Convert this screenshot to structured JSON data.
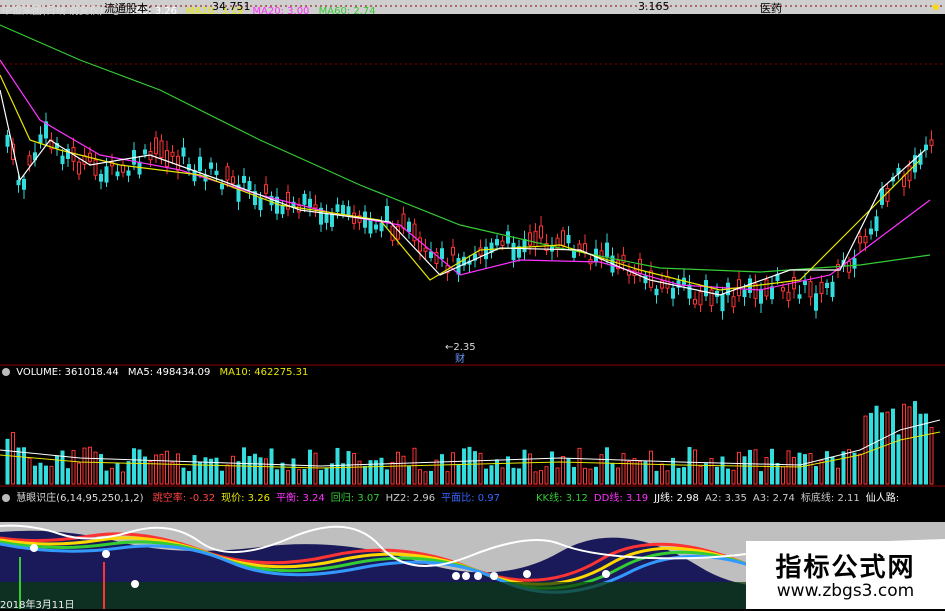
{
  "header": {
    "stock": "中恒集团(日线 前复权)",
    "ma": [
      {
        "label": "MA5:",
        "value": "3.26",
        "color": "#ffffff"
      },
      {
        "label": "MA10:",
        "value": "3.19",
        "color": "#e8e800"
      },
      {
        "label": "MA20:",
        "value": "3.00",
        "color": "#ff33ff"
      },
      {
        "label": "MA60:",
        "value": "2.74",
        "color": "#33cc33"
      }
    ]
  },
  "price_annotation": {
    "low_label": "←2.35",
    "note": "财"
  },
  "volume": {
    "label": "VOLUME:",
    "value": "361018.44",
    "ma5_label": "MA5:",
    "ma5": "498434.09",
    "ma10_label": "MA10:",
    "ma10": "462275.31"
  },
  "indicator": {
    "name": "慧眼识庄(6,14,95,250,1,2)",
    "items": [
      {
        "label": "跳空率:",
        "value": "-0.32",
        "color": "#ff4444"
      },
      {
        "label": "现价:",
        "value": "3.26",
        "color": "#e8e800"
      },
      {
        "label": "平衡:",
        "value": "3.24",
        "color": "#ff33ff"
      },
      {
        "label": "回归:",
        "value": "3.07",
        "color": "#33cc33"
      },
      {
        "label": "HZ2:",
        "value": "2.96",
        "color": "#cccccc"
      },
      {
        "label": "平面比:",
        "value": "0.97",
        "color": "#3366ff"
      },
      {
        "label": "KK线:",
        "value": "3.12",
        "color": "#33cc33"
      },
      {
        "label": "DD线:",
        "value": "3.19",
        "color": "#ff33ff"
      },
      {
        "label": "JJ线:",
        "value": "2.98",
        "color": "#ffffff"
      },
      {
        "label": "A2:",
        "value": "3.35",
        "color": "#cccccc"
      },
      {
        "label": "A3:",
        "value": "2.74",
        "color": "#cccccc"
      },
      {
        "label": "标底线:",
        "value": "2.11",
        "color": "#cccccc"
      },
      {
        "label": "仙人路:",
        "value": "",
        "color": "#ffffff"
      }
    ]
  },
  "info": {
    "label1": "流通股本:",
    "value1": "34.751",
    "value2": "3.165",
    "label3": "医药"
  },
  "date_strip": "2018年3月11日",
  "watermark": {
    "title": "指标公式网",
    "url": "www.zbgs3.com"
  },
  "colors": {
    "up": "#ff3333",
    "down": "#33dddd",
    "ma5": "#ffffff",
    "ma10": "#e8e800",
    "ma20": "#ff33ff",
    "ma60": "#33cc33"
  }
}
